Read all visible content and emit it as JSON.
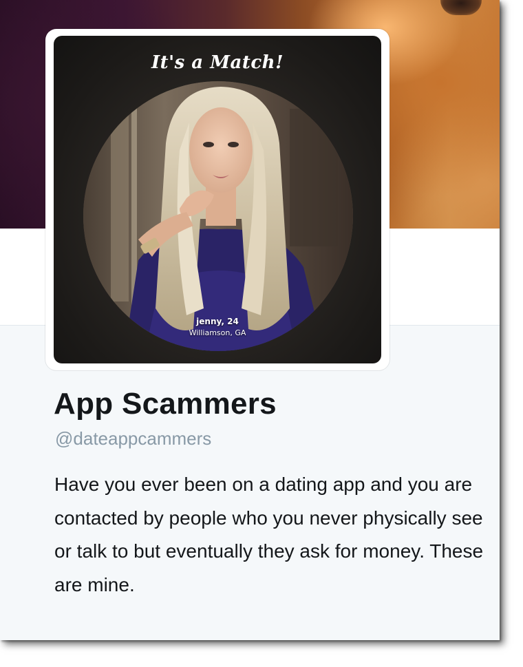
{
  "match_card": {
    "title": "It's a Match!",
    "name_age": "jenny, 24",
    "location": "Williamson, GA"
  },
  "profile": {
    "display_name": "App Scammers",
    "handle": "@dateappcammers",
    "bio": "Have you ever been on a dating app and you are contacted by people who you never physically see or talk to but eventually they ask for money. These are mine."
  },
  "colors": {
    "name_text": "#14171a",
    "handle_text": "#8899a6",
    "profile_background": "#f5f8fa"
  }
}
